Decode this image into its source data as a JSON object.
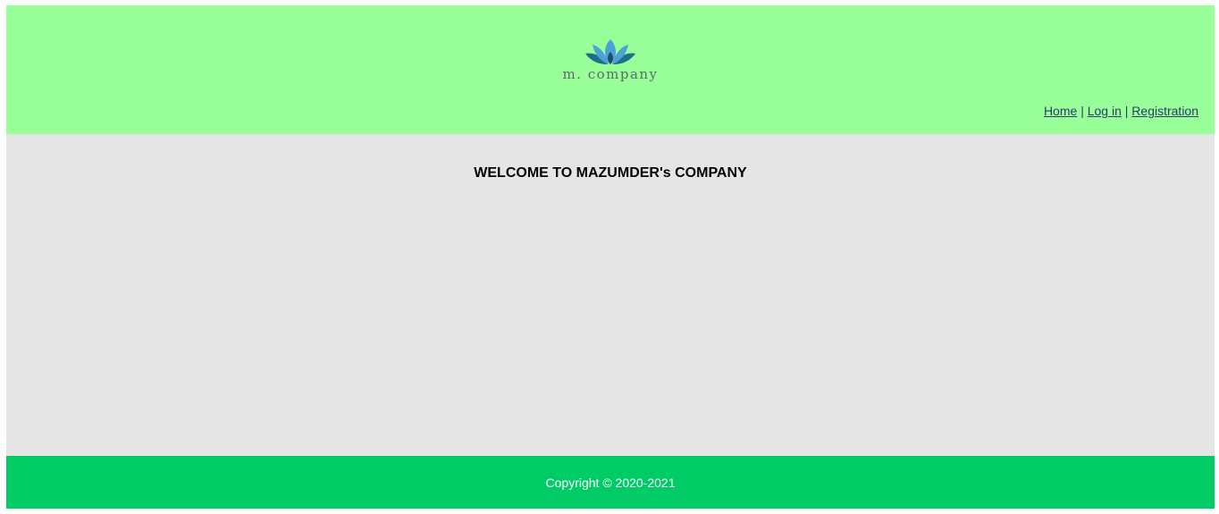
{
  "colors": {
    "header_bg": "#99ff99",
    "main_bg": "#e5e5e5",
    "footer_bg": "#00cc66",
    "link": "#2d3b6e",
    "logo_petal_light": "#4ba3d4",
    "logo_petal_dark": "#1f6f8b"
  },
  "header": {
    "logo": {
      "icon": "lotus-icon",
      "text": "m. company"
    },
    "nav": {
      "items": [
        {
          "label": "Home"
        },
        {
          "label": "Log in"
        },
        {
          "label": "Registration"
        }
      ],
      "separator": "|"
    }
  },
  "main": {
    "title": "WELCOME TO MAZUMDER's COMPANY"
  },
  "footer": {
    "copyright": "Copyright © 2020-2021"
  }
}
